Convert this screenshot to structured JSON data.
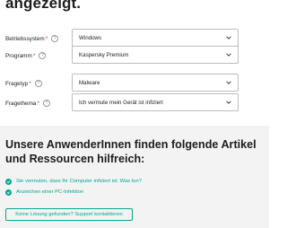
{
  "heading": "angezeigt.",
  "form": {
    "rows": [
      {
        "label": "Betriebssystem",
        "required": "*",
        "value": "Windows"
      },
      {
        "label": "Programm",
        "required": "*",
        "value": "Kaspersky Premium"
      },
      {
        "label": "Fragetyp",
        "required": "*",
        "value": "Malware"
      },
      {
        "label": "Fragethema",
        "required": "*",
        "value": "Ich vermute mein Gerät ist infiziert"
      }
    ],
    "help_glyph": "?"
  },
  "resources": {
    "title": "Unsere AnwenderInnen finden folgende Artikel und Ressourcen hilfreich:",
    "links": [
      "Sie vermuten, dass Ihr Computer infiziert ist. Was tun?",
      "Anzeichen einer PC-Infektion"
    ],
    "support_button": "Keine Lösung gefunden? Support kontaktieren"
  },
  "colors": {
    "accent": "#00a88e",
    "required": "#e0204d",
    "text": "#1d1d1b",
    "section_bg": "#f3f3f3"
  }
}
